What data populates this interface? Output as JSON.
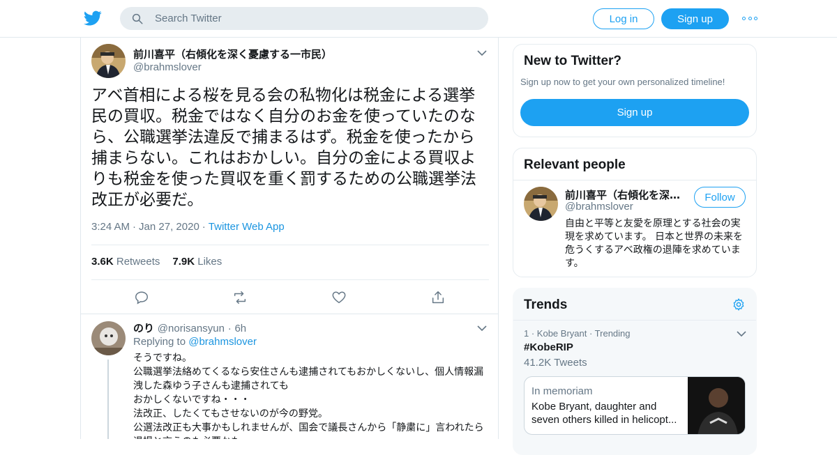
{
  "header": {
    "search_placeholder": "Search Twitter",
    "login_label": "Log in",
    "signup_label": "Sign up",
    "brand_color": "#1da1f2"
  },
  "tweet": {
    "author_name": "前川喜平（右傾化を深く憂慮する一市民）",
    "author_handle": "@brahmslover",
    "text": "アベ首相による桜を見る会の私物化は税金による選挙民の買収。税金ではなく自分のお金を使っていたのなら、公職選挙法違反で捕まるはず。税金を使ったから捕まらない。これはおかしい。自分の金による買収よりも税金を使った買収を重く罰するための公職選挙法改正が必要だ。",
    "time": "3:24 AM",
    "date": "Jan 27, 2020",
    "source": "Twitter Web App",
    "retweets_count": "3.6K",
    "retweets_label": "Retweets",
    "likes_count": "7.9K",
    "likes_label": "Likes"
  },
  "reply": {
    "author_name": "のり",
    "author_handle": "@norisansyun",
    "age": "6h",
    "replying_prefix": "Replying to",
    "replying_to": "@brahmslover",
    "text": "そうですね。\n公職選挙法絡めてくるなら安住さんも逮捕されてもおかしくないし、個人情報漏洩した森ゆう子さんも逮捕されても\nおかしくないですね・・・\n法改正、したくてもさせないのが今の野党。\n公選法改正も大事かもしれませんが、国会で議長さんから「静粛に」言われたら退場と言うのも必要かも。"
  },
  "sidebar": {
    "new_title": "New to Twitter?",
    "new_sub": "Sign up now to get your own personalized timeline!",
    "new_button": "Sign up",
    "people_title": "Relevant people",
    "person_name": "前川喜平（右傾化を深く憂慮する一市民）",
    "person_handle": "@brahmslover",
    "follow_label": "Follow",
    "person_bio": "自由と平等と友愛を原理とする社会の実現を求めています。 日本と世界の未来を危うくするアベ政権の退陣を求めています。",
    "trends_title": "Trends",
    "trend_rank": "1",
    "trend_topic": "Kobe Bryant",
    "trend_status": "Trending",
    "trend_name": "#KobeRIP",
    "trend_count": "41.2K Tweets",
    "trend_card_label": "In memoriam",
    "trend_card_headline": "Kobe Bryant, daughter and seven others killed in helicopt..."
  }
}
